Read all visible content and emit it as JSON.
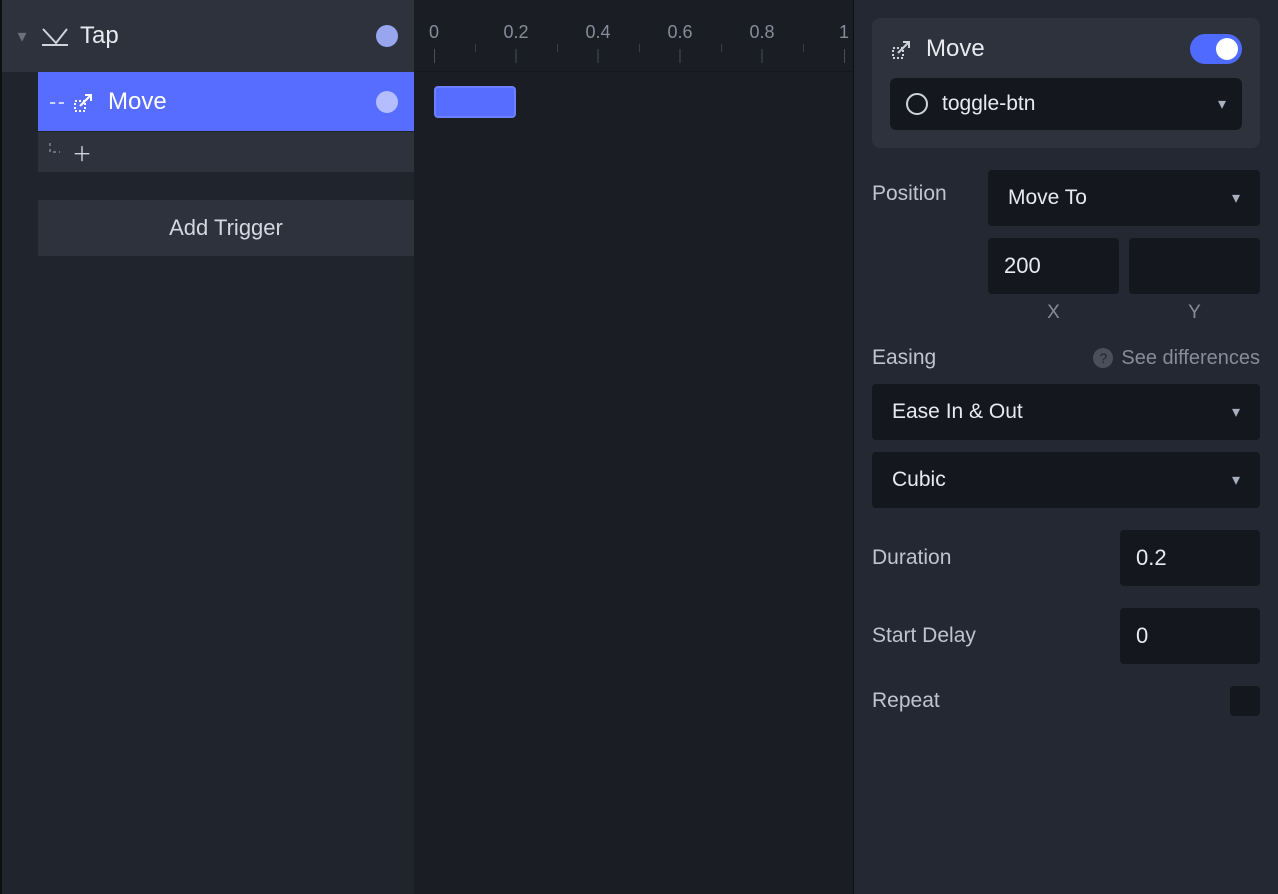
{
  "left": {
    "trigger_label": "Tap",
    "action_label": "Move",
    "add_trigger_label": "Add Trigger"
  },
  "timeline": {
    "ticks": [
      "0",
      "0.2",
      "0.4",
      "0.6",
      "0.8",
      "1"
    ]
  },
  "inspector": {
    "title": "Move",
    "target": "toggle-btn",
    "position_label": "Position",
    "position_mode": "Move To",
    "x": "200",
    "y": "",
    "x_label": "X",
    "y_label": "Y",
    "easing_label": "Easing",
    "see_diff": "See differences",
    "easing_type": "Ease In & Out",
    "easing_curve": "Cubic",
    "duration_label": "Duration",
    "duration": "0.2",
    "delay_label": "Start Delay",
    "delay": "0",
    "repeat_label": "Repeat"
  }
}
